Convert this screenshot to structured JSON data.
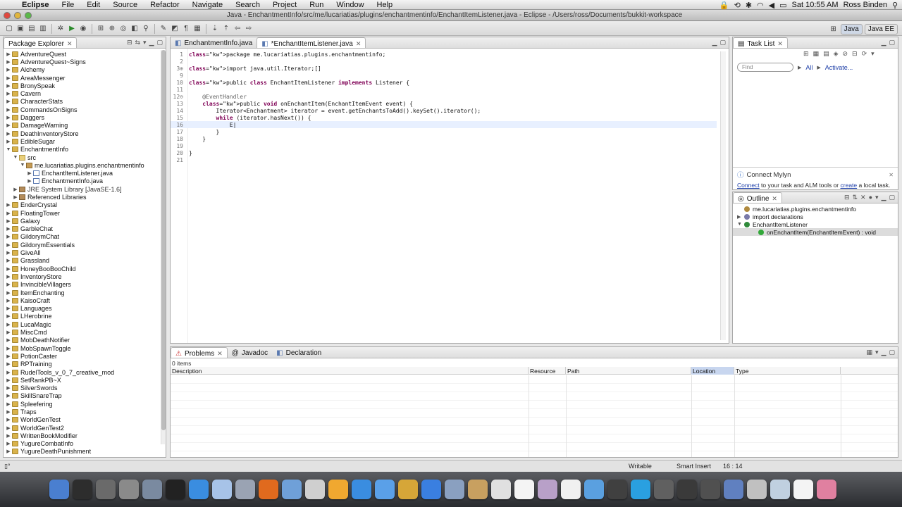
{
  "menubar": {
    "app": "Eclipse",
    "items": [
      "File",
      "Edit",
      "Source",
      "Refactor",
      "Navigate",
      "Search",
      "Project",
      "Run",
      "Window",
      "Help"
    ],
    "clock": "Sat 10:55 AM",
    "user": "Ross Binden"
  },
  "window": {
    "title": "Java - EnchantmentInfo/src/me/lucariatias/plugins/enchantmentinfo/EnchantItemListener.java - Eclipse - /Users/ross/Documents/bukkit-workspace"
  },
  "perspectives": [
    "Java",
    "Java EE"
  ],
  "package_explorer": {
    "tab": "Package Explorer",
    "items": [
      {
        "label": "AdventureQuest",
        "type": "proj",
        "arrow": "▶",
        "indent": 0
      },
      {
        "label": "AdventureQuest~Signs",
        "type": "proj",
        "arrow": "▶",
        "indent": 0
      },
      {
        "label": "Alchemy",
        "type": "proj",
        "arrow": "▶",
        "indent": 0
      },
      {
        "label": "AreaMessenger",
        "type": "proj",
        "arrow": "▶",
        "indent": 0
      },
      {
        "label": "BronySpeak",
        "type": "proj",
        "arrow": "▶",
        "indent": 0
      },
      {
        "label": "Cavern",
        "type": "proj",
        "arrow": "▶",
        "indent": 0
      },
      {
        "label": "CharacterStats",
        "type": "proj",
        "arrow": "▶",
        "indent": 0
      },
      {
        "label": "CommandsOnSigns",
        "type": "proj",
        "arrow": "▶",
        "indent": 0
      },
      {
        "label": "Daggers",
        "type": "proj",
        "arrow": "▶",
        "indent": 0
      },
      {
        "label": "DamageWarning",
        "type": "proj",
        "arrow": "▶",
        "indent": 0
      },
      {
        "label": "DeathInventoryStore",
        "type": "proj",
        "arrow": "▶",
        "indent": 0
      },
      {
        "label": "EdibleSugar",
        "type": "proj",
        "arrow": "▶",
        "indent": 0
      },
      {
        "label": "EnchantmentInfo",
        "type": "proj",
        "arrow": "▼",
        "indent": 0
      },
      {
        "label": "src",
        "type": "folder",
        "arrow": "▼",
        "indent": 1
      },
      {
        "label": "me.lucariatias.plugins.enchantmentinfo",
        "type": "pkgi",
        "arrow": "▼",
        "indent": 2
      },
      {
        "label": "EnchantItemListener.java",
        "type": "java",
        "arrow": "▶",
        "indent": 3
      },
      {
        "label": "EnchantmentInfo.java",
        "type": "java",
        "arrow": "▶",
        "indent": 3
      },
      {
        "label": "JRE System Library [JavaSE-1.6]",
        "type": "lib",
        "arrow": "▶",
        "indent": 1
      },
      {
        "label": "Referenced Libraries",
        "type": "lib",
        "arrow": "▶",
        "indent": 1
      },
      {
        "label": "EnderCrystal",
        "type": "proj",
        "arrow": "▶",
        "indent": 0
      },
      {
        "label": "FloatingTower",
        "type": "proj",
        "arrow": "▶",
        "indent": 0
      },
      {
        "label": "Galaxy",
        "type": "proj",
        "arrow": "▶",
        "indent": 0
      },
      {
        "label": "GarbleChat",
        "type": "proj",
        "arrow": "▶",
        "indent": 0
      },
      {
        "label": "GildorymChat",
        "type": "proj",
        "arrow": "▶",
        "indent": 0
      },
      {
        "label": "GildorymEssentials",
        "type": "proj",
        "arrow": "▶",
        "indent": 0
      },
      {
        "label": "GiveAll",
        "type": "proj",
        "arrow": "▶",
        "indent": 0
      },
      {
        "label": "Grassland",
        "type": "proj",
        "arrow": "▶",
        "indent": 0
      },
      {
        "label": "HoneyBooBooChild",
        "type": "proj",
        "arrow": "▶",
        "indent": 0
      },
      {
        "label": "InventoryStore",
        "type": "proj",
        "arrow": "▶",
        "indent": 0
      },
      {
        "label": "InvincibleVillagers",
        "type": "proj",
        "arrow": "▶",
        "indent": 0
      },
      {
        "label": "ItemEnchanting",
        "type": "proj",
        "arrow": "▶",
        "indent": 0
      },
      {
        "label": "KaisoCraft",
        "type": "proj",
        "arrow": "▶",
        "indent": 0
      },
      {
        "label": "Languages",
        "type": "proj",
        "arrow": "▶",
        "indent": 0
      },
      {
        "label": "LHerobrine",
        "type": "proj",
        "arrow": "▶",
        "indent": 0
      },
      {
        "label": "LucaMagic",
        "type": "proj",
        "arrow": "▶",
        "indent": 0
      },
      {
        "label": "MiscCmd",
        "type": "proj",
        "arrow": "▶",
        "indent": 0
      },
      {
        "label": "MobDeathNotifier",
        "type": "proj",
        "arrow": "▶",
        "indent": 0
      },
      {
        "label": "MobSpawnToggle",
        "type": "proj",
        "arrow": "▶",
        "indent": 0
      },
      {
        "label": "PotionCaster",
        "type": "proj",
        "arrow": "▶",
        "indent": 0
      },
      {
        "label": "RPTraining",
        "type": "proj",
        "arrow": "▶",
        "indent": 0
      },
      {
        "label": "RudelTools_v_0_7_creative_mod",
        "type": "proj",
        "arrow": "▶",
        "indent": 0
      },
      {
        "label": "SetRankPB~X",
        "type": "proj",
        "arrow": "▶",
        "indent": 0
      },
      {
        "label": "SilverSwords",
        "type": "proj",
        "arrow": "▶",
        "indent": 0
      },
      {
        "label": "SkillSnareTrap",
        "type": "proj",
        "arrow": "▶",
        "indent": 0
      },
      {
        "label": "Spleefering",
        "type": "proj",
        "arrow": "▶",
        "indent": 0
      },
      {
        "label": "Traps",
        "type": "proj",
        "arrow": "▶",
        "indent": 0
      },
      {
        "label": "WorldGenTest",
        "type": "proj",
        "arrow": "▶",
        "indent": 0
      },
      {
        "label": "WorldGenTest2",
        "type": "proj",
        "arrow": "▶",
        "indent": 0
      },
      {
        "label": "WrittenBookModifier",
        "type": "proj",
        "arrow": "▶",
        "indent": 0
      },
      {
        "label": "YugureCombatInfo",
        "type": "proj",
        "arrow": "▶",
        "indent": 0
      },
      {
        "label": "YugureDeathPunishment",
        "type": "proj",
        "arrow": "▶",
        "indent": 0
      }
    ]
  },
  "editor": {
    "tabs": [
      "EnchantmentInfo.java",
      "*EnchantItemListener.java"
    ],
    "active_tab": 1,
    "lines": [
      {
        "n": "1",
        "text": "package me.lucariatias.plugins.enchantmentinfo;"
      },
      {
        "n": "2",
        "text": ""
      },
      {
        "n": "3⊕",
        "text": "import java.util.Iterator;[]"
      },
      {
        "n": "9",
        "text": ""
      },
      {
        "n": "10",
        "text": "public class EnchantItemListener implements Listener {"
      },
      {
        "n": "11",
        "text": ""
      },
      {
        "n": "12⊖",
        "text": "    @EventHandler"
      },
      {
        "n": "13",
        "text": "    public void onEnchantItem(EnchantItemEvent event) {"
      },
      {
        "n": "14",
        "text": "        Iterator<Enchantment> iterator = event.getEnchantsToAdd().keySet().iterator();"
      },
      {
        "n": "15",
        "text": "        while (iterator.hasNext()) {"
      },
      {
        "n": "16",
        "text": "            E|"
      },
      {
        "n": "17",
        "text": "        }"
      },
      {
        "n": "18",
        "text": "    }"
      },
      {
        "n": "19",
        "text": ""
      },
      {
        "n": "20",
        "text": "}"
      },
      {
        "n": "21",
        "text": ""
      }
    ]
  },
  "task_list": {
    "tab": "Task List",
    "find_placeholder": "Find",
    "all": "All",
    "activate": "Activate...",
    "mylyn_title": "Connect Mylyn",
    "mylyn_connect": "Connect",
    "mylyn_mid": "to your task and ALM tools or",
    "mylyn_create": "create",
    "mylyn_end": "a local task."
  },
  "outline": {
    "tab": "Outline",
    "items": [
      {
        "label": "me.lucariatias.plugins.enchantmentinfo",
        "arrow": "",
        "color": "#b08a3e"
      },
      {
        "label": "import declarations",
        "arrow": "▶",
        "color": "#7a7aa8"
      },
      {
        "label": "EnchantItemListener",
        "arrow": "▼",
        "color": "#2f8a3a"
      },
      {
        "label": "onEnchantItem(EnchantItemEvent) : void",
        "arrow": "",
        "color": "#33a83a"
      }
    ]
  },
  "problems": {
    "tabs": [
      "Problems",
      "Javadoc",
      "Declaration"
    ],
    "count": "0 items",
    "columns": [
      "Description",
      "Resource",
      "Path",
      "Location",
      "Type"
    ]
  },
  "status": {
    "writable": "Writable",
    "insert": "Smart Insert",
    "position": "16 : 14"
  },
  "colors": {
    "keyword": "#7f0055",
    "annotation": "#646464",
    "current_line": "#e8f0ff",
    "link": "#1e3fa8"
  },
  "dock": [
    "finder-icon",
    "activity-monitor-icon",
    "app-icon",
    "system-preferences-icon",
    "disk-utility-icon",
    "terminal-icon",
    "app-store-icon",
    "preview-icon",
    "script-editor-icon",
    "firefox-icon",
    "mail-icon",
    "app-icon",
    "app-icon",
    "safari-icon",
    "itunes-icon",
    "star-icon",
    "dropbox-icon",
    "virtualbox-icon",
    "app-icon",
    "app-icon",
    "document-icon",
    "app-icon",
    "minecraft-icon",
    "messages-icon",
    "camera-icon",
    "skype-icon",
    "app-icon",
    "app-icon",
    "app-icon",
    "network-icon",
    "photo-icon",
    "folder-icon",
    "document-icon",
    "app-icon"
  ]
}
